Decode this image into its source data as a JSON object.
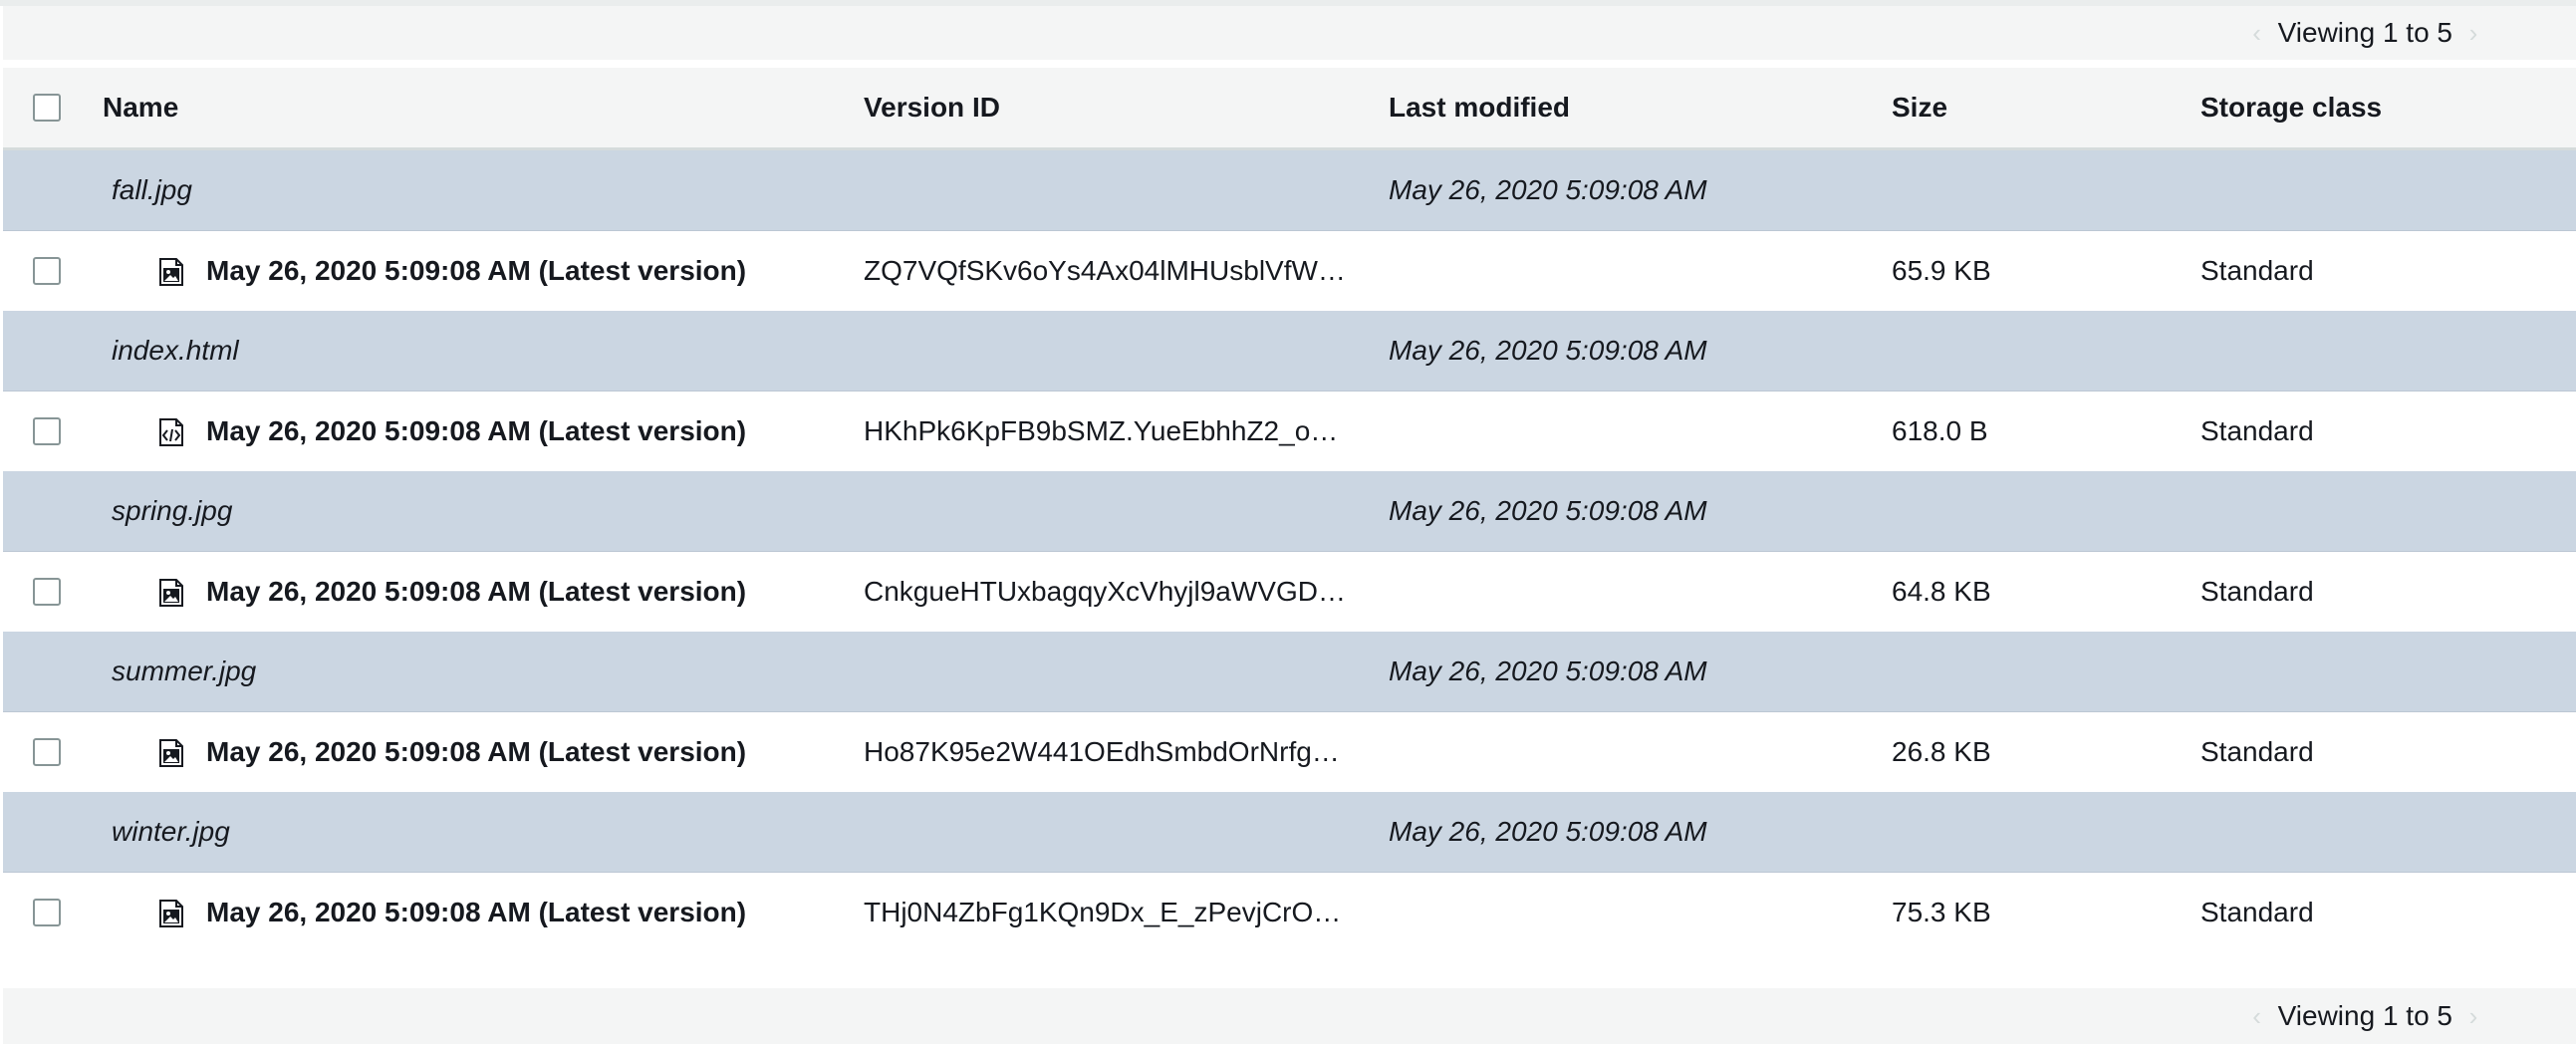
{
  "pagination": {
    "label": "Viewing 1 to 5",
    "prev_icon": "chevron-left-icon",
    "next_icon": "chevron-right-icon"
  },
  "table": {
    "columns": [
      "Name",
      "Version ID",
      "Last modified",
      "Size",
      "Storage class"
    ],
    "objects": [
      {
        "name": "fall.jpg",
        "modified": "May 26, 2020 5:09:08 AM",
        "version_label": "May 26, 2020 5:09:08 AM (Latest version)",
        "version_id": "ZQ7VQfSKv6oYs4Ax04lMHUsblVfW…",
        "size": "65.9 KB",
        "storage_class": "Standard",
        "icon": "image-file-icon"
      },
      {
        "name": "index.html",
        "modified": "May 26, 2020 5:09:08 AM",
        "version_label": "May 26, 2020 5:09:08 AM (Latest version)",
        "version_id": "HKhPk6KpFB9bSMZ.YueEbhhZ2_o…",
        "size": "618.0 B",
        "storage_class": "Standard",
        "icon": "code-file-icon"
      },
      {
        "name": "spring.jpg",
        "modified": "May 26, 2020 5:09:08 AM",
        "version_label": "May 26, 2020 5:09:08 AM (Latest version)",
        "version_id": "CnkgueHTUxbagqyXcVhyjl9aWVGD…",
        "size": "64.8 KB",
        "storage_class": "Standard",
        "icon": "image-file-icon"
      },
      {
        "name": "summer.jpg",
        "modified": "May 26, 2020 5:09:08 AM",
        "version_label": "May 26, 2020 5:09:08 AM (Latest version)",
        "version_id": "Ho87K95e2W441OEdhSmbdOrNrfg…",
        "size": "26.8 KB",
        "storage_class": "Standard",
        "icon": "image-file-icon"
      },
      {
        "name": "winter.jpg",
        "modified": "May 26, 2020 5:09:08 AM",
        "version_label": "May 26, 2020 5:09:08 AM (Latest version)",
        "version_id": "THj0N4ZbFg1KQn9Dx_E_zPevjCrO…",
        "size": "75.3 KB",
        "storage_class": "Standard",
        "icon": "image-file-icon"
      }
    ]
  }
}
